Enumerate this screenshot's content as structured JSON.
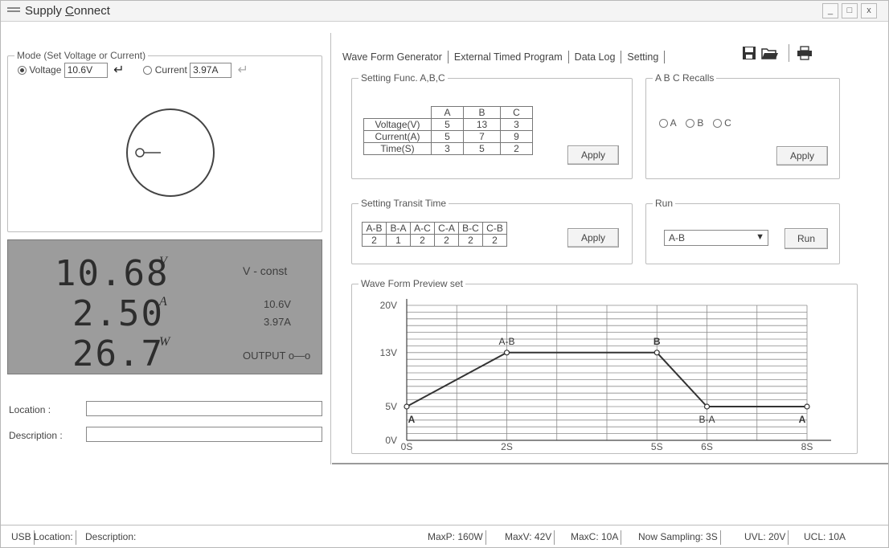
{
  "window": {
    "title_pre": "Supply ",
    "title_underlined": "C",
    "title_post": "onnect",
    "buttons": [
      "_",
      "□",
      "x"
    ]
  },
  "mode": {
    "group_title": "Mode (Set Voltage or Current)",
    "voltage_label": "Voltage",
    "voltage_value": "10.6V",
    "current_label": "Current",
    "current_value": "3.97A",
    "selected": "voltage"
  },
  "display": {
    "voltage_reading": "10.68",
    "voltage_unit": "V",
    "current_reading": "2.50",
    "current_unit": "A",
    "power_reading": "26.7",
    "power_unit": "W",
    "mode_text": "V - const",
    "set_voltage": "10.6V",
    "set_current": "3.97A",
    "output_text": "OUTPUT o—o"
  },
  "fields": {
    "location_label": "Location :",
    "description_label": "Description :",
    "location_value": "",
    "description_value": ""
  },
  "tabs": [
    "Wave Form Generator",
    "External Timed Program",
    "Data Log",
    "Setting"
  ],
  "toolbar_icons": [
    "save-icon",
    "open-folder-icon",
    "print-icon"
  ],
  "setting_func": {
    "group_title": "Setting Func. A,B,C",
    "columns": [
      "A",
      "B",
      "C"
    ],
    "rows": [
      {
        "label": "Voltage(V)",
        "values": [
          "5",
          "13",
          "3"
        ]
      },
      {
        "label": "Current(A)",
        "values": [
          "5",
          "7",
          "9"
        ]
      },
      {
        "label": "Time(S)",
        "values": [
          "3",
          "5",
          "2"
        ]
      }
    ],
    "apply_label": "Apply"
  },
  "recalls": {
    "group_title": "A B C Recalls",
    "options": [
      "A",
      "B",
      "C"
    ],
    "apply_label": "Apply"
  },
  "transit": {
    "group_title": "Setting Transit Time",
    "headers": [
      "A-B",
      "B-A",
      "A-C",
      "C-A",
      "B-C",
      "C-B"
    ],
    "values": [
      "2",
      "1",
      "2",
      "2",
      "2",
      "2"
    ],
    "apply_label": "Apply"
  },
  "run": {
    "group_title": "Run",
    "selected": "A-B",
    "run_label": "Run"
  },
  "preview": {
    "group_title": "Wave Form Preview set",
    "y_ticks": [
      {
        "label": "20V",
        "v": 20
      },
      {
        "label": "13V",
        "v": 13
      },
      {
        "label": "5V",
        "v": 5
      },
      {
        "label": "0V",
        "v": 0
      }
    ],
    "x_ticks": [
      {
        "label": "0S",
        "t": 0
      },
      {
        "label": "2S",
        "t": 2
      },
      {
        "label": "5S",
        "t": 5
      },
      {
        "label": "6S",
        "t": 6
      },
      {
        "label": "8S",
        "t": 8
      }
    ],
    "points": [
      {
        "t": 0,
        "v": 5,
        "label": "A"
      },
      {
        "t": 2,
        "v": 13,
        "label": "A-B"
      },
      {
        "t": 5,
        "v": 13,
        "label": "B"
      },
      {
        "t": 6,
        "v": 5,
        "label": "B-A"
      },
      {
        "t": 8,
        "v": 5,
        "label": "A"
      }
    ]
  },
  "status": {
    "items": [
      "USB",
      "Location:",
      "Description:"
    ],
    "right_items": [
      "MaxP: 160W",
      "MaxV: 42V",
      "MaxC: 10A",
      "Now Sampling: 3S",
      "UVL: 20V",
      "UCL: 10A"
    ]
  },
  "colors": {
    "lcd_background": "#9c9c9c",
    "lcd_text": "#2d2d2d"
  }
}
